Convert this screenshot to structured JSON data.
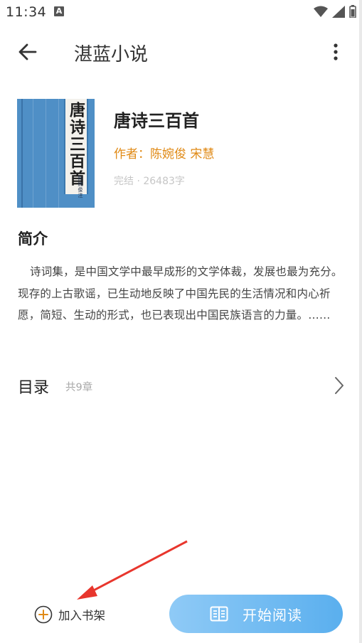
{
  "status_bar": {
    "time": "11:34",
    "notification_icon": "A",
    "icons": [
      "wifi-icon",
      "signal-icon",
      "battery-icon"
    ]
  },
  "app_bar": {
    "title": "湛蓝小说",
    "back_icon": "arrow-left-icon",
    "more_icon": "more-vertical-icon"
  },
  "book": {
    "title": "唐诗三百首",
    "author": "作者：陈婉俊 宋慧",
    "status": "完结 · 26483字",
    "cover_title": "唐诗三百首",
    "cover_publisher": "陈婉俊注"
  },
  "intro": {
    "heading": "简介",
    "text": "诗词集，是中国文学中最早成形的文学体裁，发展也最为充分。现存的上古歌谣，已生动地反映了中国先民的生活情况和内心祈愿，简短、生动的形式，也已表现出中国民族语言的力量。……"
  },
  "catalog": {
    "label": "目录",
    "count": "共9章",
    "chevron_icon": "chevron-right-icon"
  },
  "bottom_bar": {
    "add_to_shelf": "加入书架",
    "start_reading": "开始阅读",
    "plus_icon": "plus-circle-icon",
    "book_icon": "open-book-icon"
  },
  "colors": {
    "accent_orange": "#e08a16",
    "button_blue_start": "#8fcaf6",
    "button_blue_end": "#5aafee",
    "annotation_red": "#e8362d",
    "cover_blue": "#4f8fc6"
  }
}
